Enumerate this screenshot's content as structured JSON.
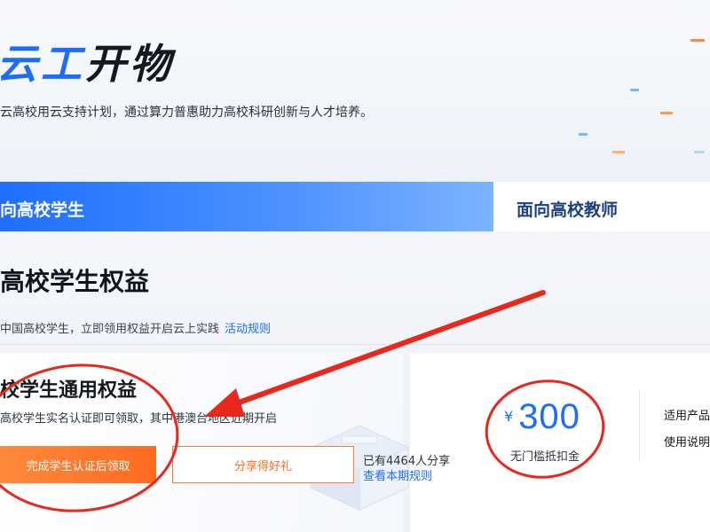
{
  "hero": {
    "title_accent": "云工",
    "title_rest": "开物",
    "subtitle": "云高校用云支持计划，通过算力普惠助力高校科研创新与人才培养。"
  },
  "tabs": [
    {
      "label": "向高校学生",
      "active": true
    },
    {
      "label": "面向高校教师",
      "active": false
    }
  ],
  "section": {
    "title": "高校学生权益",
    "subtitle": "中国高校学生，立即领用权益开启云上实践",
    "rules_link": "活动规则"
  },
  "benefit_card": {
    "title": "校学生通用权益",
    "description": "高校学生实名认证即可领取，其中港澳台地区近期开启",
    "primary_button": "完成学生认证后领取",
    "share_button": "分享得好礼",
    "share_count": "已有4464人分享",
    "share_rules_link": "查看本期规则"
  },
  "coupon": {
    "currency": "¥",
    "amount": "300",
    "label": "无门槛抵扣金",
    "applicable_products": "适用产品",
    "usage": "使用说明"
  },
  "colors": {
    "brand_blue": "#1d6bff",
    "accent_orange": "#ff6a1f",
    "annotation_red": "#e8281d"
  }
}
